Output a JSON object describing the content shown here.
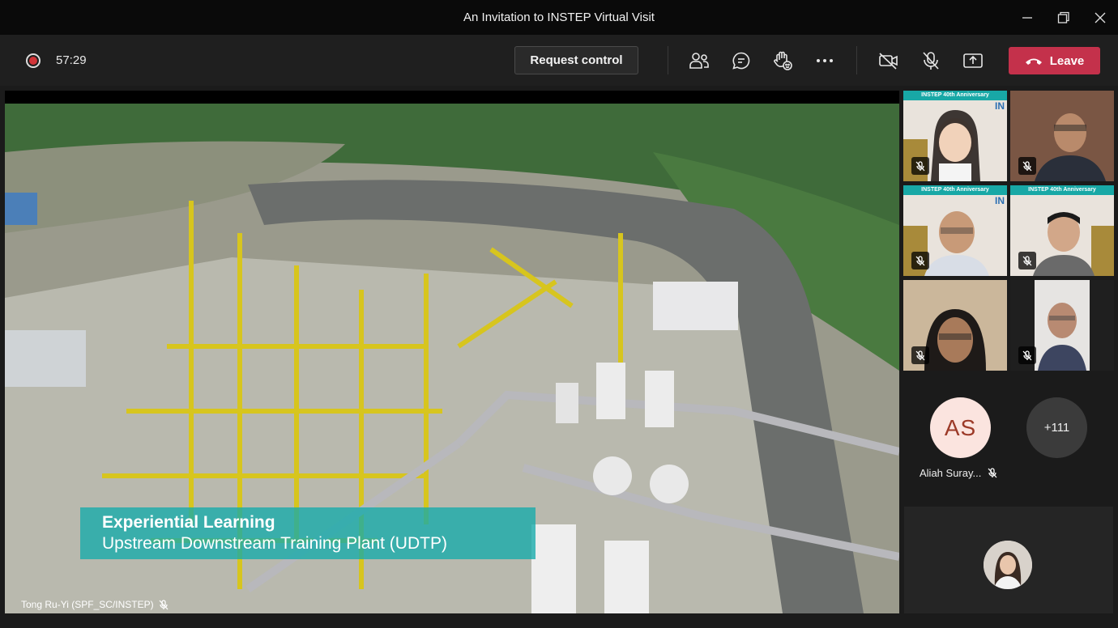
{
  "window": {
    "title": "An Invitation to INSTEP Virtual Visit"
  },
  "toolbar": {
    "timer": "57:29",
    "request_control_label": "Request control",
    "leave_label": "Leave"
  },
  "shared_screen": {
    "caption_title": "Experiential Learning",
    "caption_subtitle": "Upstream Downstream Training Plant (UDTP)",
    "presenter_name": "Tong Ru-Yi (SPF_SC/INSTEP)"
  },
  "participants": {
    "banner_text": "INSTEP 40th Anniversary",
    "banner_logo": "IN",
    "aliah_initials": "AS",
    "aliah_name": "Aliah Suray...",
    "more_count": "+111"
  },
  "colors": {
    "leave": "#c4314b",
    "record": "#d13438",
    "caption": "#14aaaa"
  }
}
